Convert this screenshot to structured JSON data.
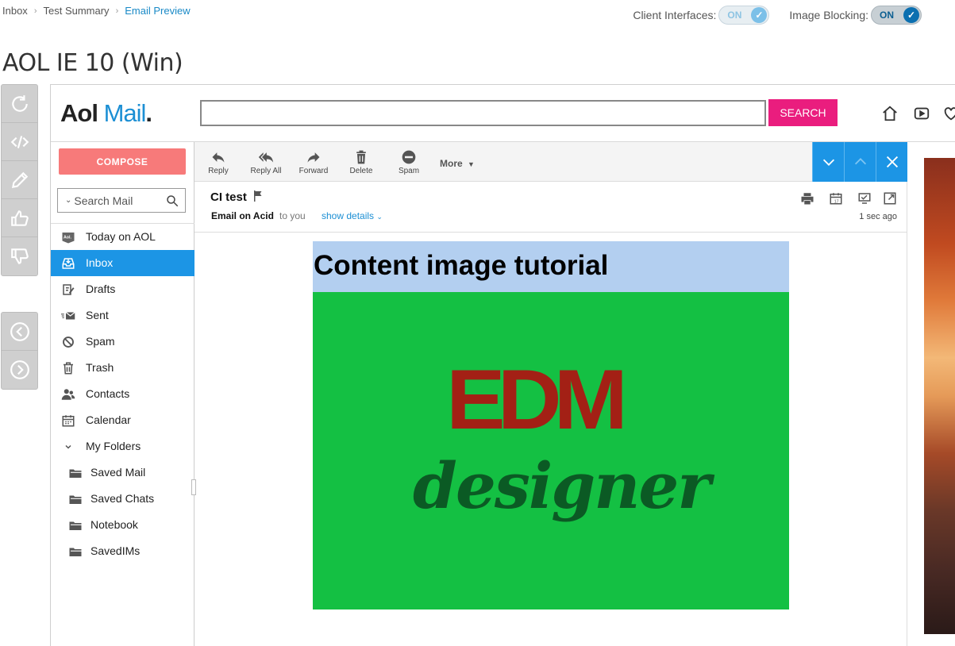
{
  "breadcrumb": [
    {
      "label": "Inbox"
    },
    {
      "label": "Test Summary"
    },
    {
      "label": "Email Preview"
    }
  ],
  "toggles": {
    "client_interfaces": {
      "label": "Client Interfaces:",
      "state": "ON"
    },
    "image_blocking": {
      "label": "Image Blocking:",
      "state": "ON"
    }
  },
  "client_title": "AOL IE 10 (Win)",
  "rail_icons": [
    "refresh-icon",
    "code-icon",
    "pencil-icon",
    "thumbs-up-icon",
    "thumbs-down-icon",
    "prev-icon",
    "next-icon"
  ],
  "aol": {
    "logo_aol": "Aol",
    "logo_mail": "Mail",
    "logo_dot": ".",
    "search_button": "SEARCH",
    "compose": "COMPOSE",
    "search_mail_placeholder": "Search Mail",
    "nav": [
      {
        "label": "Today on AOL",
        "icon": "aol-icon"
      },
      {
        "label": "Inbox",
        "icon": "inbox-icon"
      },
      {
        "label": "Drafts",
        "icon": "drafts-icon"
      },
      {
        "label": "Sent",
        "icon": "sent-icon"
      },
      {
        "label": "Spam",
        "icon": "spam-icon"
      },
      {
        "label": "Trash",
        "icon": "trash-icon"
      },
      {
        "label": "Contacts",
        "icon": "contacts-icon"
      },
      {
        "label": "Calendar",
        "icon": "calendar-icon"
      },
      {
        "label": "My Folders",
        "icon": "chevron-down-icon"
      },
      {
        "label": "Saved Mail",
        "icon": "folder-icon"
      },
      {
        "label": "Saved Chats",
        "icon": "folder-icon"
      },
      {
        "label": "Notebook",
        "icon": "folder-icon"
      },
      {
        "label": "SavedIMs",
        "icon": "folder-icon"
      }
    ],
    "toolbar": {
      "reply": "Reply",
      "reply_all": "Reply All",
      "forward": "Forward",
      "delete": "Delete",
      "spam": "Spam",
      "more": "More"
    },
    "message": {
      "subject": "CI test",
      "from": "Email on Acid",
      "to": "to you",
      "show_details": "show details",
      "time": "1 sec ago"
    },
    "email": {
      "title": "Content image tutorial",
      "image_text_1": "EDM",
      "image_text_2": "designer"
    }
  },
  "colors": {
    "accent_blue": "#1c95e5",
    "search_pink": "#ea1d7e",
    "compose_red": "#f77a7a",
    "email_title_bg": "#b3cff0",
    "email_image_bg": "#14c043"
  }
}
